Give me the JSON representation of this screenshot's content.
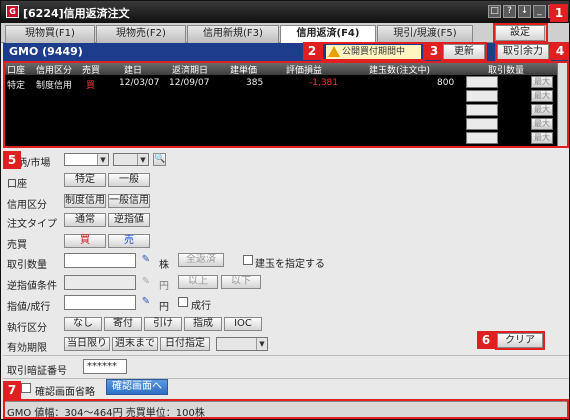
{
  "window": {
    "title": "[6224]信用返済注文",
    "app_icon": "G"
  },
  "window_buttons": [
    "□",
    "?",
    "↓",
    "_",
    "×"
  ],
  "tabs": [
    {
      "label": "現物買(F1)"
    },
    {
      "label": "現物売(F2)"
    },
    {
      "label": "信用新規(F3)"
    },
    {
      "label": "信用返済(F4)"
    },
    {
      "label": "現引/現渡(F5)"
    }
  ],
  "settings_button": "設定",
  "symbol_bar": {
    "label": "GMO (9449)",
    "warning": "公開買付期間中",
    "refresh": "更新",
    "tradable": "取引余力"
  },
  "position_grid": {
    "headers": [
      "口座",
      "信用区分",
      "売買",
      "建日",
      "返済期日",
      "建単価",
      "評価損益",
      "建玉数(注文中)",
      "取引数量"
    ],
    "rows": [
      {
        "account": "特定",
        "type": "制度信用",
        "side": "買",
        "open_date": "12/03/07",
        "due_date": "12/09/07",
        "price": "385",
        "pnl": "-1,381",
        "qty": "800",
        "action": "最大"
      }
    ],
    "empty_actions": [
      "最大",
      "最大",
      "最大",
      "最大",
      "最大"
    ]
  },
  "form": {
    "symbol_label": "銘柄/市場",
    "account_label": "口座",
    "account_options": [
      "特定",
      "一般"
    ],
    "credit_label": "信用区分",
    "credit_options": [
      "制度信用",
      "一般信用"
    ],
    "order_type_label": "注文タイプ",
    "order_type_options": [
      "通常",
      "逆指値"
    ],
    "side_label": "売買",
    "side_buy": "買",
    "side_sell": "売",
    "qty_label": "取引数量",
    "qty_unit": "株",
    "all_settle": "全返済",
    "specify_position": "建玉を指定する",
    "stop_label": "逆指値条件",
    "stop_unit": "円",
    "stop_above": "以上",
    "stop_below": "以下",
    "price_label": "指値/成行",
    "price_unit": "円",
    "market_order": "成行",
    "exec_label": "執行区分",
    "exec_options": [
      "なし",
      "寄付",
      "引け",
      "指成",
      "IOC"
    ],
    "expiry_label": "有効期限",
    "expiry_options": [
      "当日限り",
      "週末まで",
      "日付指定"
    ],
    "clear": "クリア",
    "pin_label": "取引暗証番号",
    "pin_value": "******",
    "confirm_skip": "確認画面省略",
    "confirm_button": "確認画面へ"
  },
  "status": {
    "text": "GMO 値幅：304～464円 売買単位：100株"
  },
  "annotations": [
    "1",
    "2",
    "3",
    "4",
    "5",
    "6",
    "7"
  ]
}
